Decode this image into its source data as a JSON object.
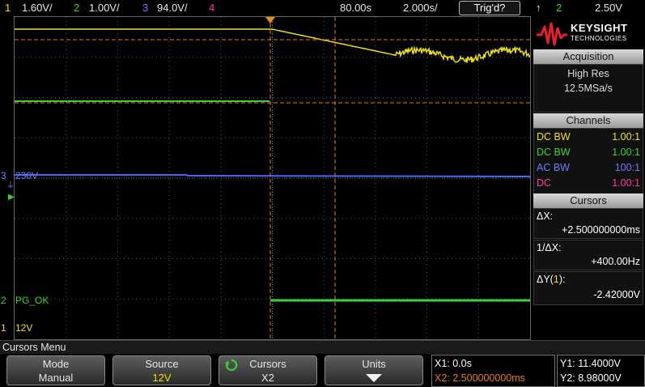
{
  "topbar": {
    "ch1_num": "1",
    "ch1_scale": "1.60V/",
    "ch2_num": "2",
    "ch2_scale": "1.00V/",
    "ch3_num": "3",
    "ch3_scale": "94.0V/",
    "ch4_num": "4",
    "time_pos": "80.00s",
    "time_scale": "2.000s/",
    "trig_status": "Trig'd?",
    "trig_icon": "↑",
    "trig_source": "2",
    "trig_level": "2.50V"
  },
  "channel_labels": {
    "ch3_marker": "3",
    "ch3_name": "230V",
    "ch2_marker": "2",
    "ch2_name": "PG_OK",
    "ch1_marker": "1",
    "ch1_name": "12V"
  },
  "panel": {
    "brand": "KEYSIGHT",
    "brand_sub": "TECHNOLOGIES",
    "acquisition_header": "Acquisition",
    "acq_mode": "High Res",
    "acq_rate": "12.5MSa/s",
    "channels_header": "Channels",
    "channels": [
      {
        "coupling": "DC BW",
        "probe": "1.00:1",
        "color": "#f0e010"
      },
      {
        "coupling": "DC BW",
        "probe": "1.00:1",
        "color": "#3ad13a"
      },
      {
        "coupling": "AC BW",
        "probe": "100:1",
        "color": "#6a7cff"
      },
      {
        "coupling": "DC",
        "probe": "1.00:1",
        "color": "#ff3aa0"
      }
    ],
    "cursors_header": "Cursors",
    "dx_label": "ΔX:",
    "dx_value": "+2.500000000ms",
    "inv_dx_label": "1/ΔX:",
    "inv_dx_value": "+400.00Hz",
    "dy_label_prefix": "ΔY(",
    "dy_label_ch": "1",
    "dy_label_suffix": "):",
    "dy_value": "-2.42000V"
  },
  "menu_title": "Cursors Menu",
  "softkeys": [
    {
      "label": "Mode",
      "value": "Manual",
      "value_color": "#e6e6e6"
    },
    {
      "label": "Source",
      "value": "12V",
      "value_color": "#f0e010"
    },
    {
      "label": "Cursors",
      "value": "X2",
      "value_color": "#e6e6e6"
    },
    {
      "label": "Units",
      "value": "",
      "value_color": "#e6e6e6"
    }
  ],
  "readout": {
    "x1": "X1: 0.0s",
    "x2": "X2: 2.500000000ms",
    "y1": "Y1: 11.4000V",
    "y2": "Y2: 8.98000V"
  },
  "colors": {
    "ch1": "#f0e010",
    "ch2": "#3ad13a",
    "ch3": "#4a64ff",
    "cursor": "#e87a1a",
    "trigger_marker": "#f08a10"
  }
}
